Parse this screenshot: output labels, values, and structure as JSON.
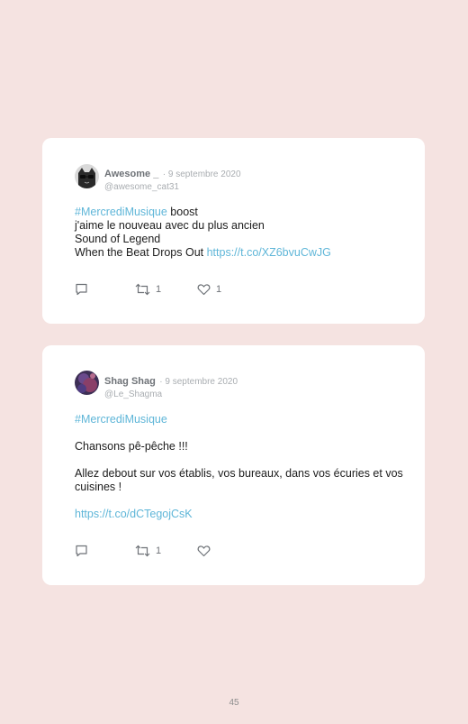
{
  "posts": [
    {
      "name": "Awesome _",
      "date": "· 9 septembre 2020",
      "handle": "@awesome_cat31",
      "hashtag": "#MercrediMusique",
      "line1_rest": " boost",
      "line2": "j'aime le nouveau avec du plus ancien",
      "line3": "Sound of Legend",
      "line4_text": "When the Beat Drops Out ",
      "line4_link": "https://t.co/XZ6bvuCwJG",
      "retweets": "1",
      "likes": "1"
    },
    {
      "name": "Shag Shag",
      "date": "· 9 septembre 2020",
      "handle": "@Le_Shagma",
      "hashtag": "#MercrediMusique",
      "line2": "Chansons pê-pêche !!!",
      "line3": "Allez debout sur vos établis, vos bureaux, dans vos écuries et vos cuisines !",
      "link": "https://t.co/dCTegojCsK",
      "retweets": "1",
      "likes": ""
    }
  ],
  "page_number": "45",
  "icons": {
    "reply": "reply-icon",
    "retweet": "retweet-icon",
    "like": "heart-icon"
  },
  "colors": {
    "background": "#f5e3e1",
    "link": "#5fb6d8",
    "muted": "#a9adb1"
  }
}
